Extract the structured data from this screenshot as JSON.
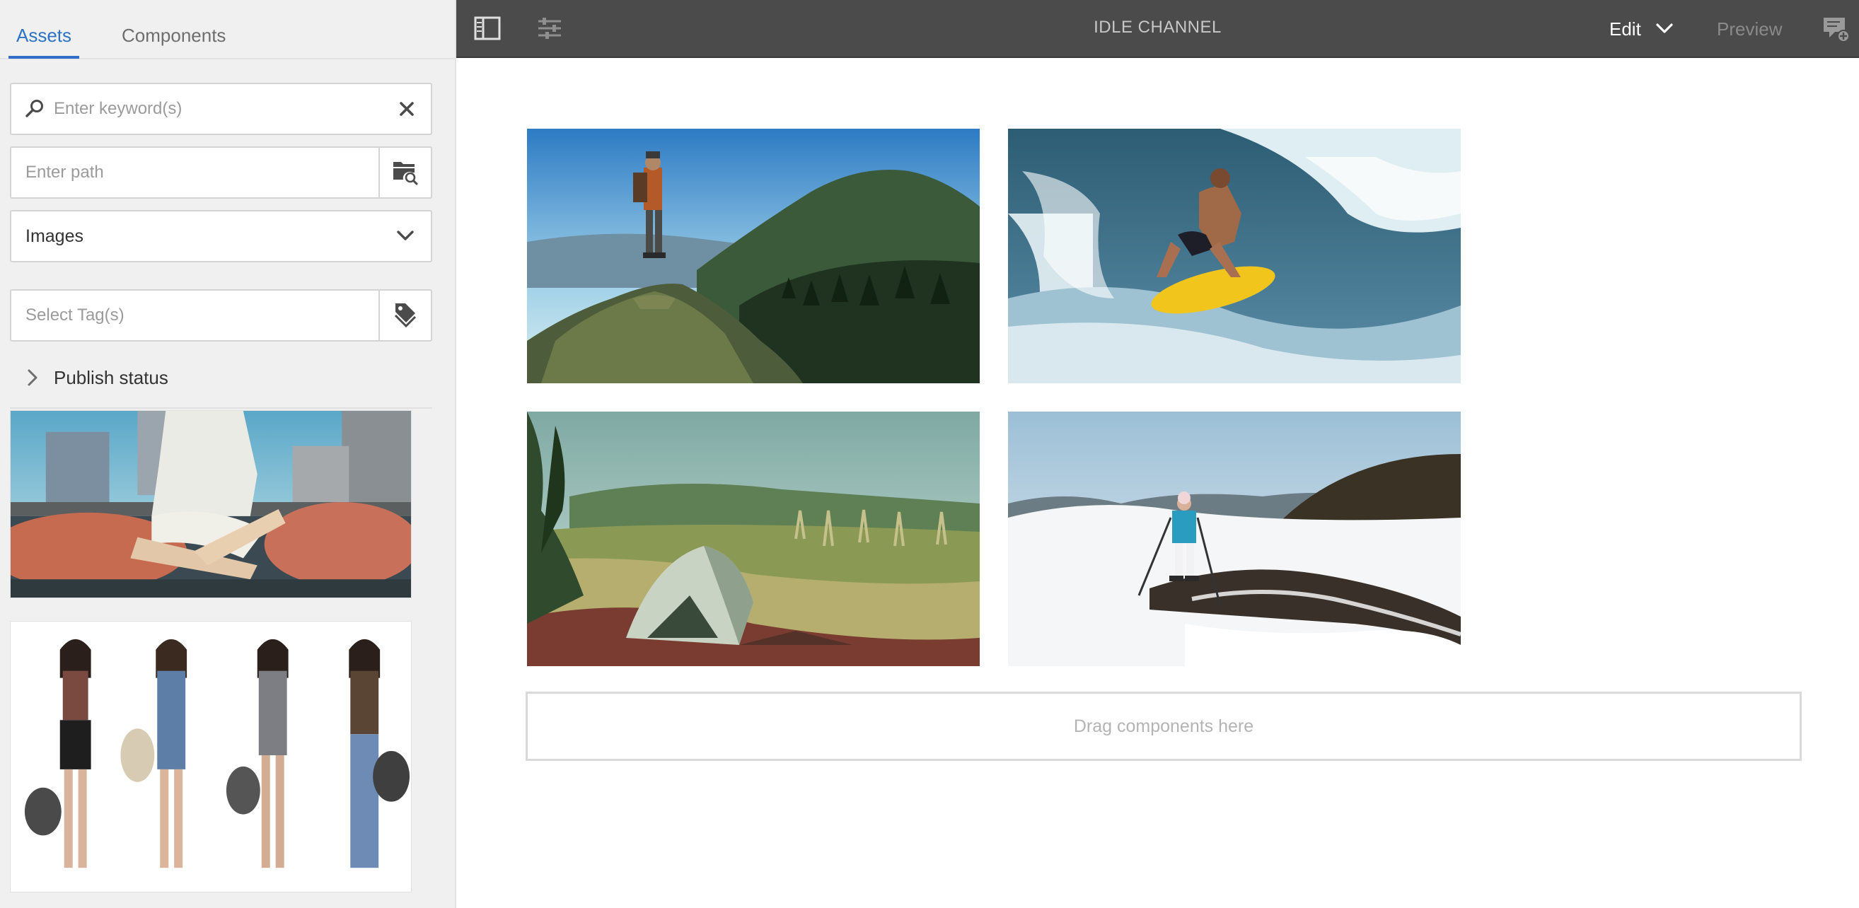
{
  "sidebar": {
    "tabs": [
      {
        "label": "Assets",
        "active": true
      },
      {
        "label": "Components",
        "active": false
      }
    ],
    "search": {
      "placeholder": "Enter keyword(s)",
      "value": ""
    },
    "path": {
      "placeholder": "Enter path",
      "value": ""
    },
    "asset_type": {
      "selected": "Images"
    },
    "tags": {
      "placeholder": "Select Tag(s)",
      "value": ""
    },
    "publish_status": {
      "label": "Publish status",
      "expanded": false
    }
  },
  "topbar": {
    "title": "IDLE CHANNEL",
    "mode": "Edit",
    "preview": "Preview"
  },
  "canvas": {
    "dropzone": "Drag components here"
  },
  "colors": {
    "accent": "#326ec8",
    "topbar": "#4b4b4b",
    "sidebar": "#f0f0f0"
  }
}
